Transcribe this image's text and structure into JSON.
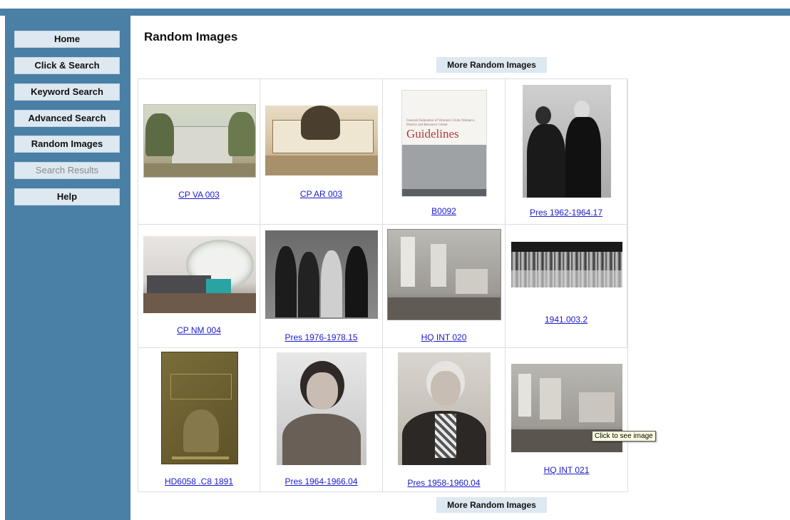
{
  "sidebar": {
    "items": [
      {
        "label": "Home",
        "enabled": true
      },
      {
        "label": "Click & Search",
        "enabled": true
      },
      {
        "label": "Keyword Search",
        "enabled": true
      },
      {
        "label": "Advanced Search",
        "enabled": true
      },
      {
        "label": "Random Images",
        "enabled": true
      },
      {
        "label": "Search Results",
        "enabled": false
      },
      {
        "label": "Help",
        "enabled": true
      }
    ]
  },
  "main": {
    "title": "Random Images",
    "more_button_label": "More Random Images",
    "images": [
      {
        "caption": "CP VA 003",
        "icon": "color-postcard-house-image"
      },
      {
        "caption": "CP AR 003",
        "icon": "sepia-postcard-building-image"
      },
      {
        "caption": "B0092",
        "icon": "booklet-cover-image"
      },
      {
        "caption": "Pres 1962-1964.17",
        "icon": "couple-portrait-image"
      },
      {
        "caption": "CP NM 004",
        "icon": "color-postcard-tree-image"
      },
      {
        "caption": "Pres 1976-1978.15",
        "icon": "group-photo-image"
      },
      {
        "caption": "HQ INT 020",
        "icon": "interior-room-image"
      },
      {
        "caption": "1941.003.2",
        "icon": "banquet-photo-image"
      },
      {
        "caption": "HD6058 .C8 1891",
        "icon": "book-cover-image"
      },
      {
        "caption": "Pres 1964-1966.04",
        "icon": "woman-portrait-image"
      },
      {
        "caption": "Pres 1958-1960.04",
        "icon": "woman-portrait-image"
      },
      {
        "caption": "HQ INT 021",
        "icon": "interior-room-image"
      }
    ],
    "booklet": {
      "title_line": "Guidelines",
      "small_text": "General Federation of Women's Clubs Women's History and Resource Center"
    }
  },
  "tooltip": {
    "text": "Click to see image"
  },
  "colors": {
    "sidebar": "#4a7fa6",
    "button": "#dde8f0",
    "link": "#1a1acc"
  }
}
